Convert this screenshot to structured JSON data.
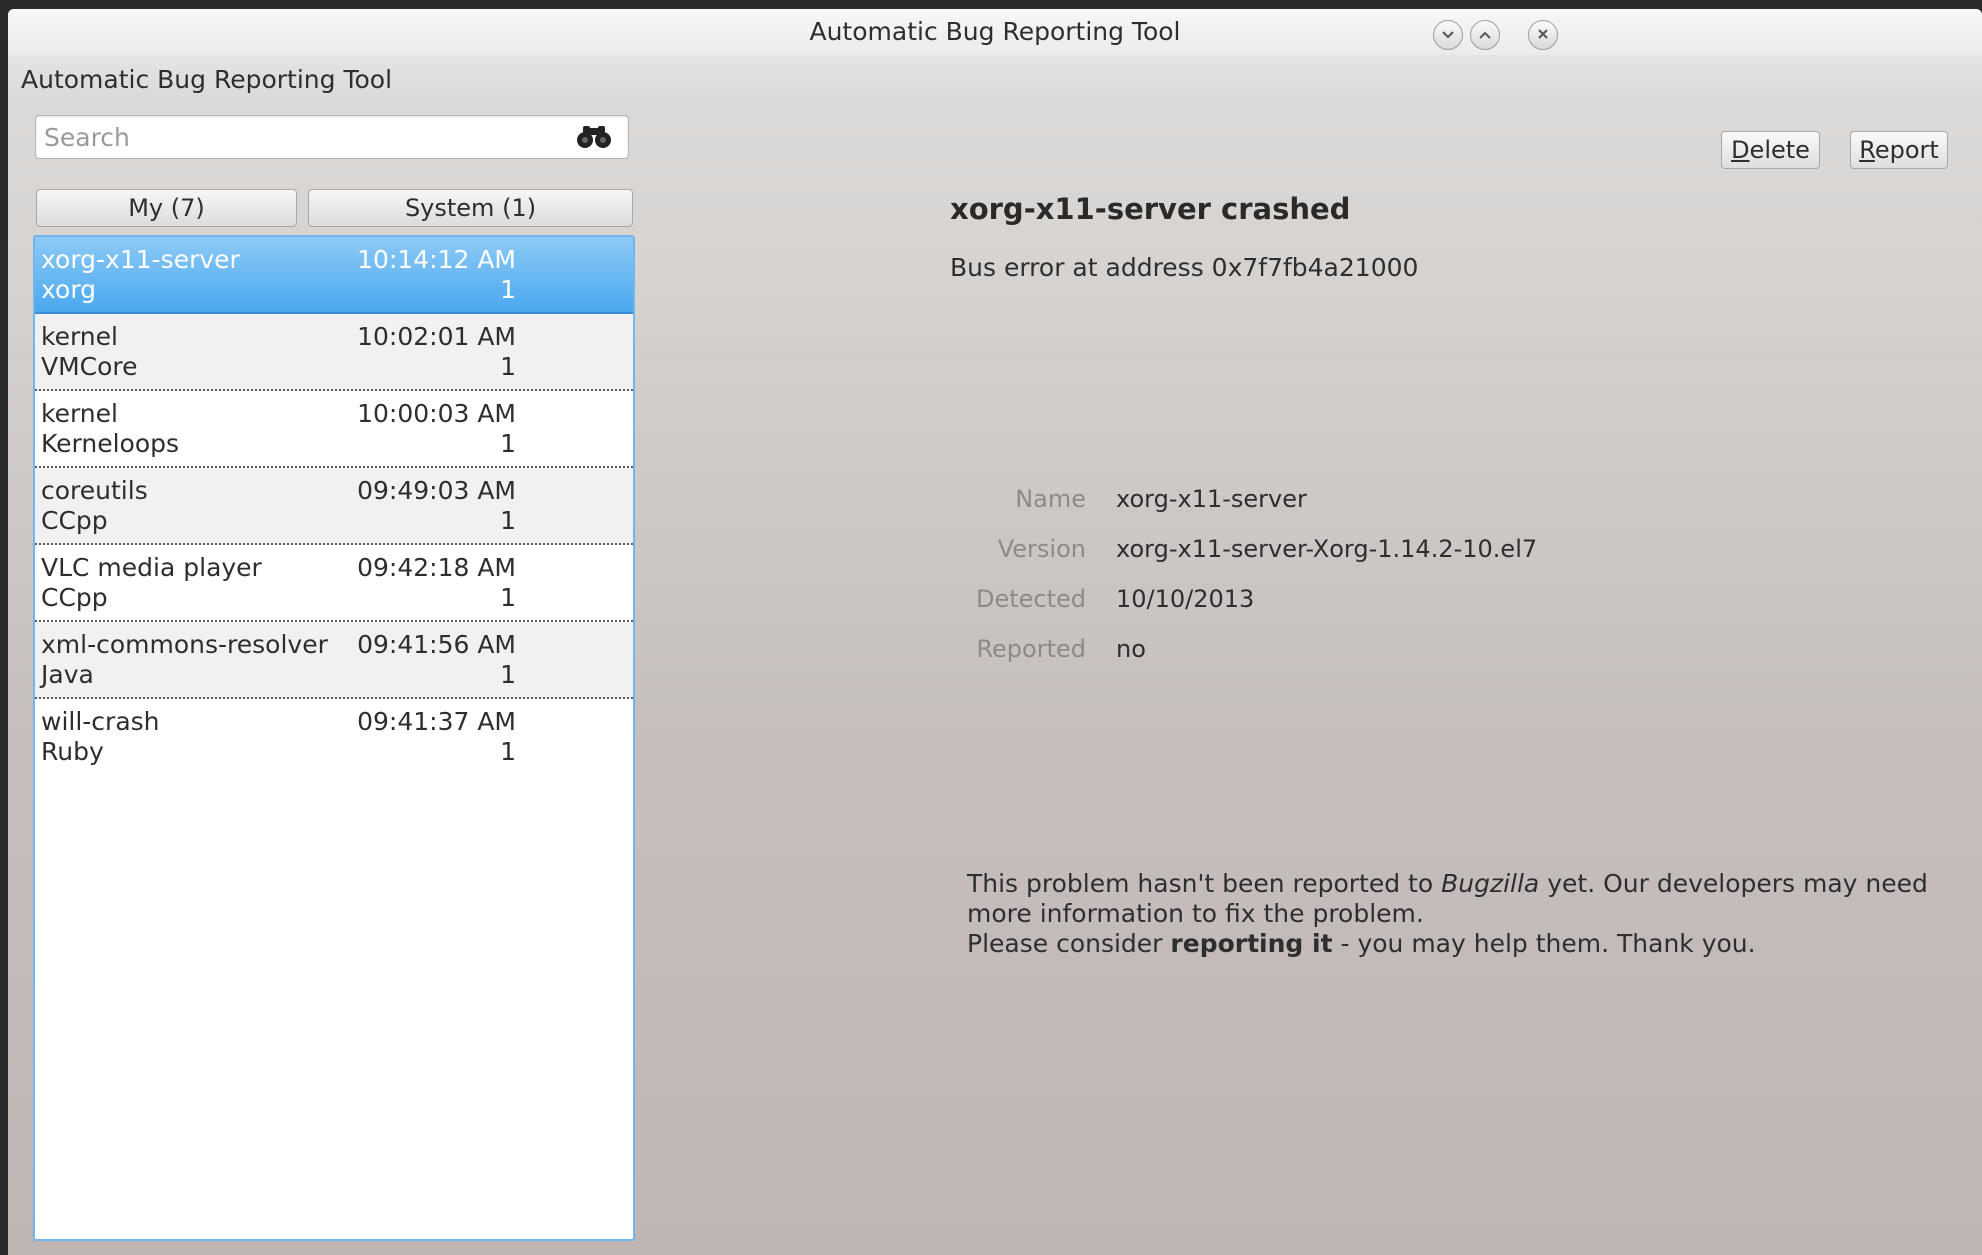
{
  "window": {
    "title": "Automatic Bug Reporting Tool"
  },
  "app_label": "Automatic Bug Reporting Tool",
  "search": {
    "placeholder": "Search",
    "value": ""
  },
  "tabs": [
    {
      "label": "My (7)",
      "selected": false
    },
    {
      "label": "System (1)",
      "selected": false
    }
  ],
  "problems": [
    {
      "name": "xorg-x11-server",
      "type": "xorg",
      "time": "10:14:12 AM",
      "count": "1",
      "selected": true
    },
    {
      "name": "kernel",
      "type": "VMCore",
      "time": "10:02:01 AM",
      "count": "1"
    },
    {
      "name": "kernel",
      "type": "Kerneloops",
      "time": "10:00:03 AM",
      "count": "1"
    },
    {
      "name": "coreutils",
      "type": "CCpp",
      "time": "09:49:03 AM",
      "count": "1"
    },
    {
      "name": "VLC media player",
      "type": "CCpp",
      "time": "09:42:18 AM",
      "count": "1"
    },
    {
      "name": "xml-commons-resolver",
      "type": "Java",
      "time": "09:41:56 AM",
      "count": "1"
    },
    {
      "name": "will-crash",
      "type": "Ruby",
      "time": "09:41:37 AM",
      "count": "1"
    }
  ],
  "toolbar": {
    "delete_mnemonic": "D",
    "delete_rest": "elete",
    "report_mnemonic": "R",
    "report_rest": "eport"
  },
  "detail": {
    "title": "xorg-x11-server crashed",
    "reason": "Bus error at address 0x7f7fb4a21000",
    "fields": [
      {
        "label": "Name",
        "value": "xorg-x11-server"
      },
      {
        "label": "Version",
        "value": "xorg-x11-server-Xorg-1.14.2-10.el7"
      },
      {
        "label": "Detected",
        "value": "10/10/2013"
      },
      {
        "label": "Reported",
        "value": "no"
      }
    ],
    "notice": {
      "part1": "This problem hasn't been reported to ",
      "bugzilla": "Bugzilla",
      "part2": " yet. Our developers may need more information to fix the problem.",
      "part3": "Please consider ",
      "reporting_it": "reporting it",
      "part4": " - you may help them. Thank you."
    }
  },
  "icons": {
    "window_minimize": "chevron-down-icon",
    "window_maximize": "chevron-up-icon",
    "window_close": "close-icon",
    "search": "binoculars-icon"
  },
  "colors": {
    "selection": "#4aa8ee",
    "list_border": "#73b5ef"
  }
}
